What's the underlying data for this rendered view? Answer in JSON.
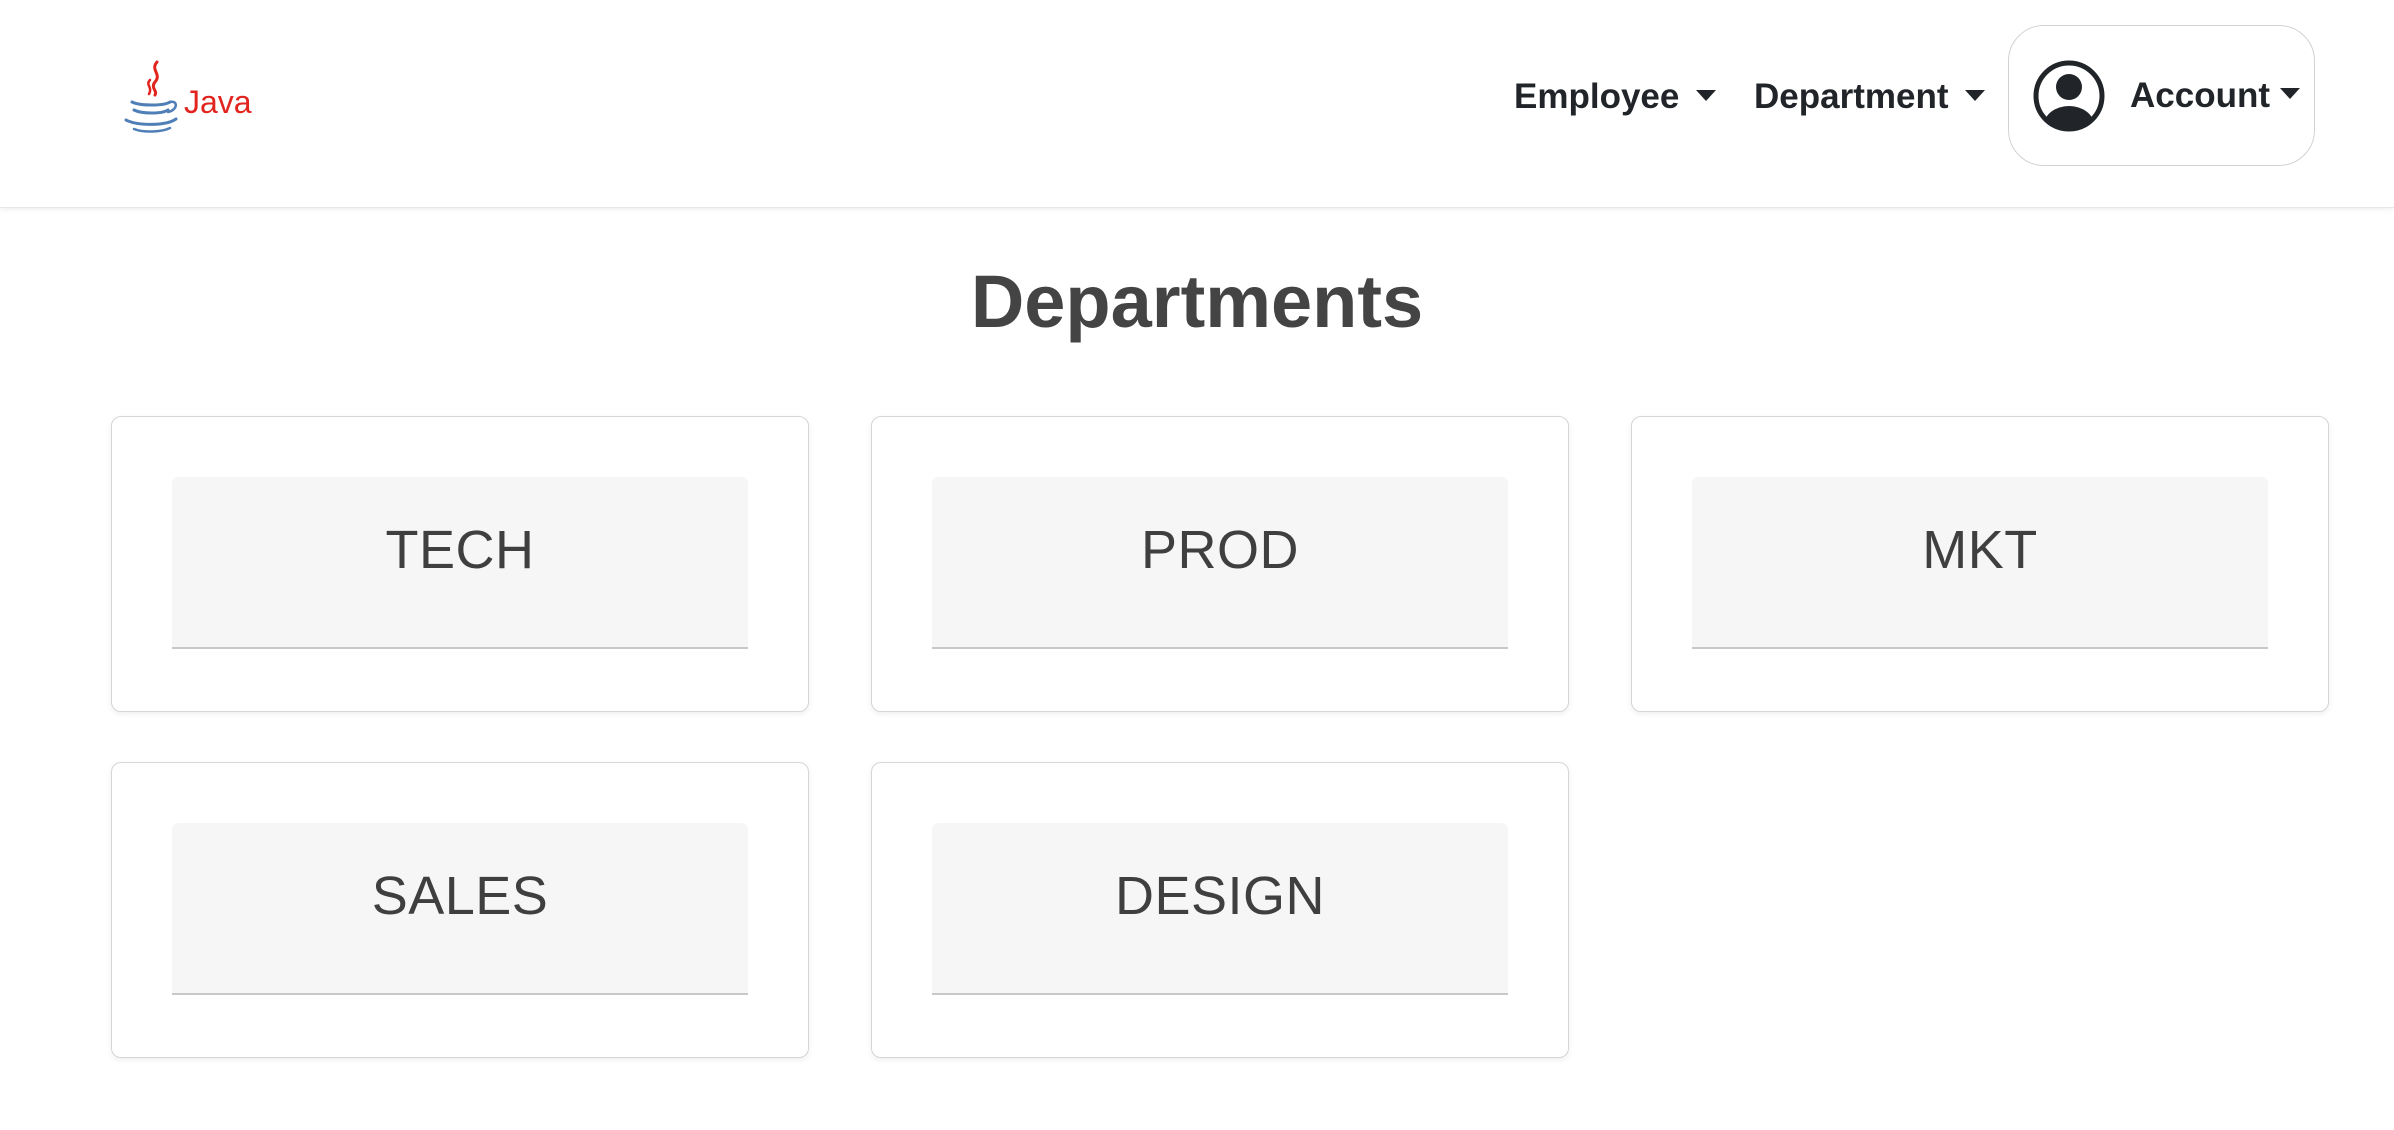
{
  "navbar": {
    "brand": {
      "logo_icon": "java-logo-icon",
      "logo_text": "Java"
    },
    "items": [
      {
        "label": "Employee",
        "icon": "caret-down-icon"
      },
      {
        "label": "Department",
        "icon": "caret-down-icon"
      }
    ],
    "account": {
      "label": "Account",
      "icon": "user-circle-icon"
    }
  },
  "main": {
    "title": "Departments",
    "departments": [
      {
        "name": "TECH"
      },
      {
        "name": "PROD"
      },
      {
        "name": "MKT"
      },
      {
        "name": "SALES"
      },
      {
        "name": "DESIGN"
      }
    ]
  },
  "colors": {
    "logo_red": "#e2241f",
    "logo_blue": "#4f7fb6",
    "title_text": "#444444",
    "card_header_bg": "#f6f6f6"
  }
}
